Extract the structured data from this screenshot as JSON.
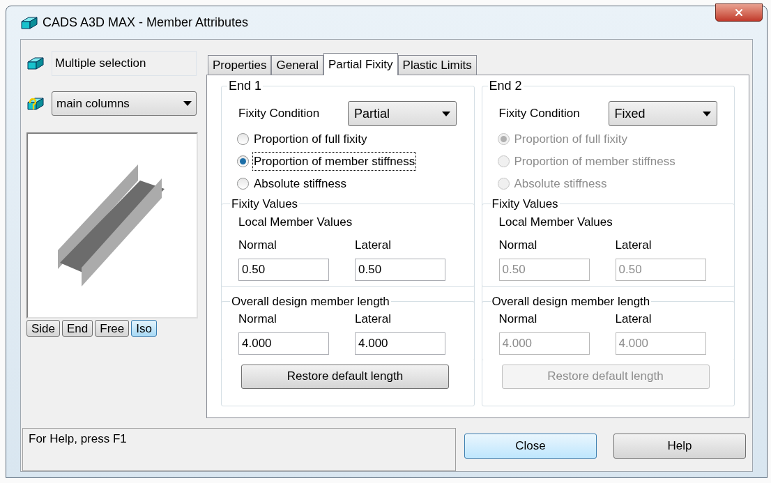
{
  "window": {
    "title": "CADS A3D MAX - Member Attributes"
  },
  "selection": {
    "text": "Multiple selection"
  },
  "group_select": {
    "value": "main columns"
  },
  "view_buttons": [
    {
      "label": "Side",
      "selected": false
    },
    {
      "label": "End",
      "selected": false
    },
    {
      "label": "Free",
      "selected": false
    },
    {
      "label": "Iso",
      "selected": true
    }
  ],
  "tabs": [
    {
      "label": "Properties",
      "selected": false
    },
    {
      "label": "General",
      "selected": false
    },
    {
      "label": "Partial Fixity",
      "selected": true
    },
    {
      "label": "Plastic Limits",
      "selected": false
    }
  ],
  "ends": [
    {
      "title": "End 1",
      "disabled": false,
      "fixity_label": "Fixity Condition",
      "fixity_value": "Partial",
      "options": [
        {
          "label": "Proportion of full fixity",
          "selected": false,
          "focused": false
        },
        {
          "label": "Proportion of member stiffness",
          "selected": true,
          "focused": true
        },
        {
          "label": "Absolute stiffness",
          "selected": false,
          "focused": false
        }
      ],
      "fixity_values": {
        "title": "Fixity Values",
        "subtitle": "Local Member Values",
        "normal_label": "Normal",
        "normal": "0.50",
        "lateral_label": "Lateral",
        "lateral": "0.50"
      },
      "length": {
        "title": "Overall design member length",
        "normal_label": "Normal",
        "normal": "4.000",
        "lateral_label": "Lateral",
        "lateral": "4.000"
      },
      "restore_button": "Restore default length"
    },
    {
      "title": "End 2",
      "disabled": true,
      "fixity_label": "Fixity Condition",
      "fixity_value": "Fixed",
      "options": [
        {
          "label": "Proportion of full fixity",
          "selected": true,
          "focused": false
        },
        {
          "label": "Proportion of member stiffness",
          "selected": false,
          "focused": false
        },
        {
          "label": "Absolute stiffness",
          "selected": false,
          "focused": false
        }
      ],
      "fixity_values": {
        "title": "Fixity Values",
        "subtitle": "Local Member Values",
        "normal_label": "Normal",
        "normal": "0.50",
        "lateral_label": "Lateral",
        "lateral": "0.50"
      },
      "length": {
        "title": "Overall design member length",
        "normal_label": "Normal",
        "normal": "4.000",
        "lateral_label": "Lateral",
        "lateral": "4.000"
      },
      "restore_button": "Restore default length"
    }
  ],
  "status": {
    "text": "For Help, press F1"
  },
  "buttons": [
    {
      "label": "Close",
      "default": true
    },
    {
      "label": "Help",
      "default": false
    }
  ]
}
